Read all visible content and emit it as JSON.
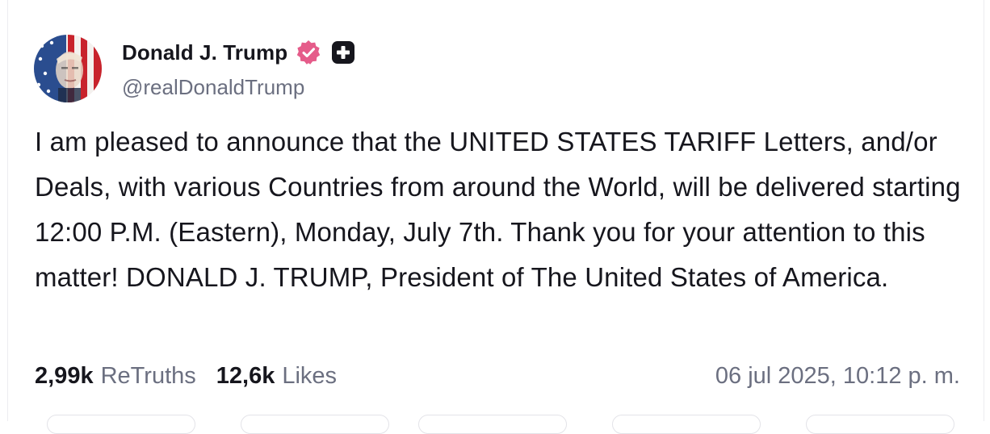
{
  "post": {
    "author": {
      "display_name": "Donald J. Trump",
      "handle": "@realDonaldTrump",
      "verified_icon": "verified-badge-icon",
      "verified_color": "#e55c8a",
      "plus_icon": "plus-badge-icon"
    },
    "text": "I am pleased to announce that the UNITED STATES TARIFF Letters, and/or Deals, with various Countries from around the World, will be delivered starting 12:00 P.M. (Eastern), Monday, July 7th. Thank you for your attention to this matter! DONALD J. TRUMP, President of The United States of America.",
    "stats": {
      "retruths_count": "2,99k",
      "retruths_label": "ReTruths",
      "likes_count": "12,6k",
      "likes_label": "Likes"
    },
    "timestamp": "06 jul 2025, 10:12 p. m."
  },
  "colors": {
    "text_primary": "#16161d",
    "text_secondary": "#6b6f80",
    "border": "#ececf0"
  }
}
